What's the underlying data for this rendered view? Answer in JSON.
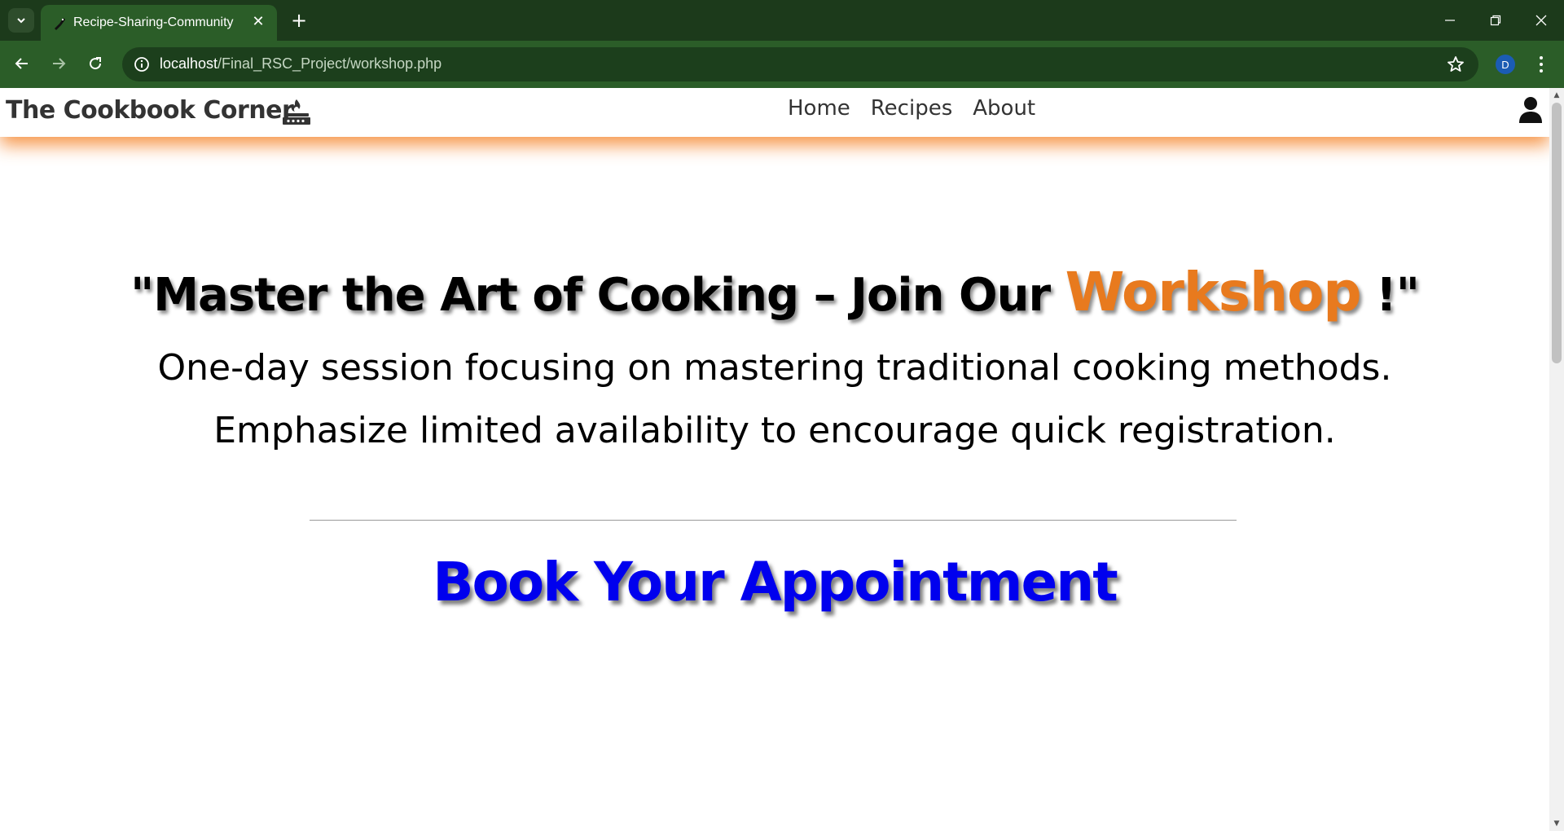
{
  "browser": {
    "tab_title": "Recipe-Sharing-Community",
    "url_host": "localhost",
    "url_path": "/Final_RSC_Project/workshop.php",
    "profile_initial": "D",
    "colors": {
      "tabbar": "#1c3a1b",
      "toolbar": "#2b5d28"
    }
  },
  "site": {
    "brand": "The Cookbook Corner",
    "brand_icon": "campfire-pot-icon",
    "nav": [
      {
        "label": "Home"
      },
      {
        "label": "Recipes"
      },
      {
        "label": "About"
      }
    ],
    "user_icon": "user-icon",
    "colors": {
      "accent": "#e87a1e",
      "booking_title": "#0000ee",
      "nav_shadow": "#f58228"
    }
  },
  "hero": {
    "headline_prefix": "\"Master the Art of Cooking – Join Our ",
    "headline_accent": "Workshop",
    "headline_suffix": " !\"",
    "line1": "One-day session focusing on mastering traditional cooking methods.",
    "line2": "Emphasize limited availability to encourage quick registration."
  },
  "booking": {
    "title": "Book Your Appointment"
  }
}
